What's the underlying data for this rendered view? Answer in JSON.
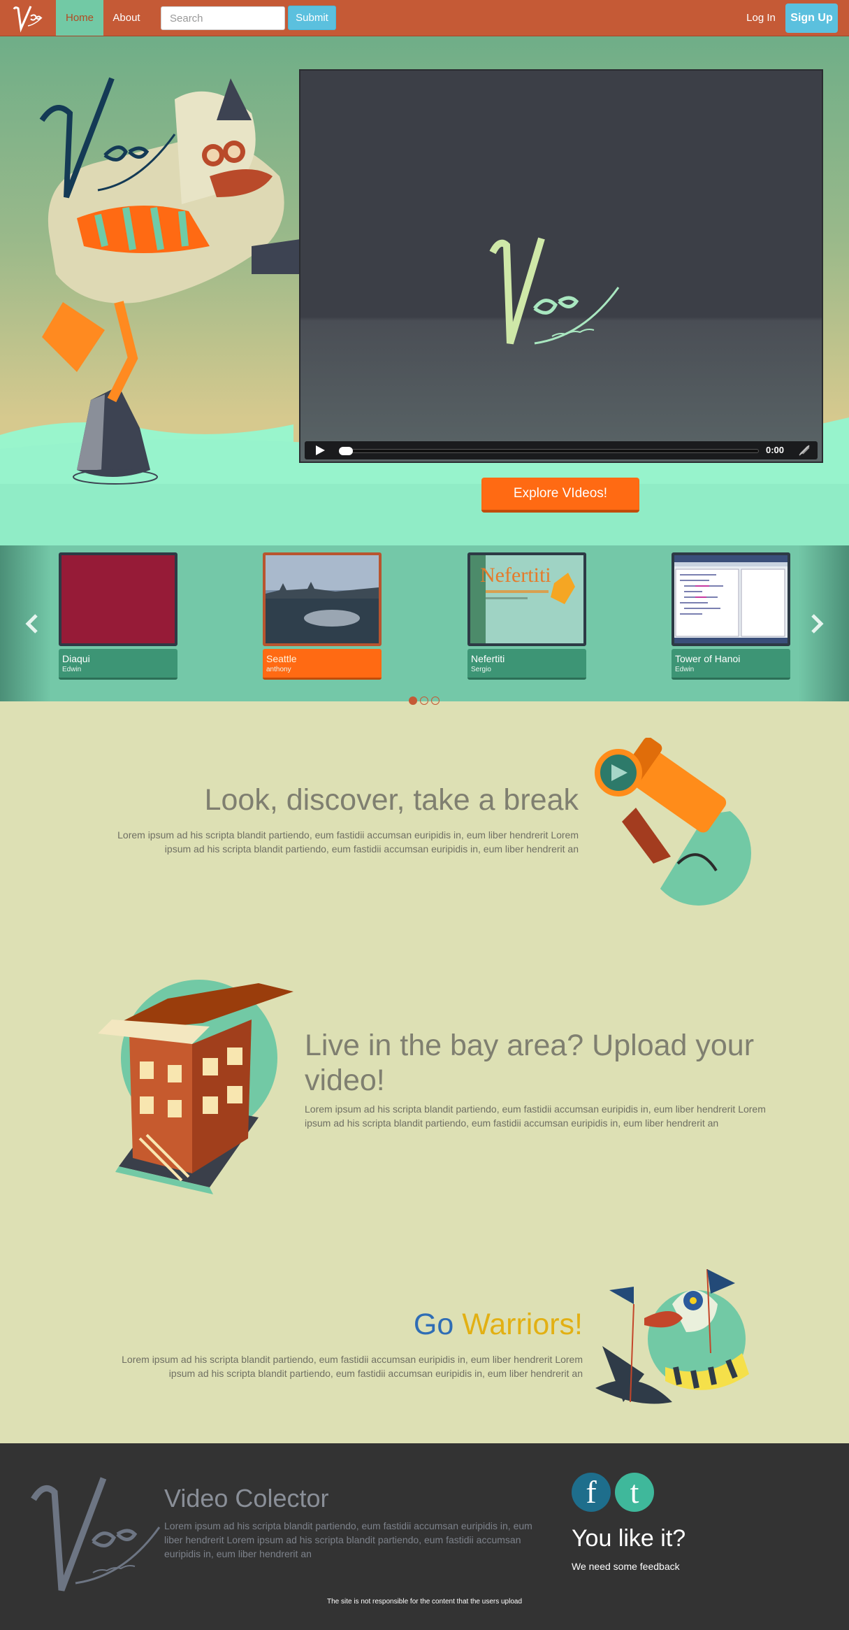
{
  "navbar": {
    "brand": "Video Collector",
    "home": "Home",
    "about": "About",
    "search_placeholder": "Search",
    "submit": "Submit",
    "login": "Log In",
    "signup": "Sign Up"
  },
  "player": {
    "time": "0:00",
    "progress": 0
  },
  "hero": {
    "explore": "Explore VIdeos!"
  },
  "carousel": {
    "items": [
      {
        "title": "Diaqui",
        "user": "Edwin"
      },
      {
        "title": "Seattle",
        "user": "anthony"
      },
      {
        "title": "Nefertiti",
        "user": "Sergio"
      },
      {
        "title": "Tower of Hanoi",
        "user": "Edwin"
      }
    ],
    "thumb_text": "Nefertiti",
    "active_index": 1,
    "pages": 3,
    "current_page": 1
  },
  "features": [
    {
      "title": "Look, discover, take a break",
      "body": "Lorem ipsum ad his scripta blandit partiendo, eum fastidii accumsan euripidis in, eum liber hendrerit Lorem ipsum ad his scripta blandit partiendo, eum fastidii accumsan euripidis in, eum liber hendrerit an"
    },
    {
      "title": "Live in the bay area? Upload your video!",
      "body": "Lorem ipsum ad his scripta blandit partiendo, eum fastidii accumsan euripidis in, eum liber hendrerit Lorem ipsum ad his scripta blandit partiendo, eum fastidii accumsan euripidis in, eum liber hendrerit an"
    },
    {
      "title_a": "Go",
      "title_b": "Warriors!",
      "body": "Lorem ipsum ad his scripta blandit partiendo, eum fastidii accumsan euripidis in, eum liber hendrerit Lorem ipsum ad his scripta blandit partiendo, eum fastidii accumsan euripidis in, eum liber hendrerit an"
    }
  ],
  "footer": {
    "title": "Video Colector",
    "body": "Lorem ipsum ad his scripta blandit partiendo, eum fastidii accumsan euripidis in, eum liber hendrerit Lorem ipsum ad his scripta blandit partiendo, eum fastidii accumsan euripidis in, eum liber hendrerit an",
    "facebook": "f",
    "twitter": "t",
    "like": "You like it?",
    "feedback": "We need some feedback",
    "disclaimer": "The site is not responsible for the content that the users upload"
  },
  "colors": {
    "navbar": "#c55a36",
    "accent_orange": "#ff6a13",
    "info_blue": "#5bc0de",
    "mint": "#74c8a8",
    "go_blue": "#2f6db5",
    "warriors_gold": "#e2b013"
  }
}
